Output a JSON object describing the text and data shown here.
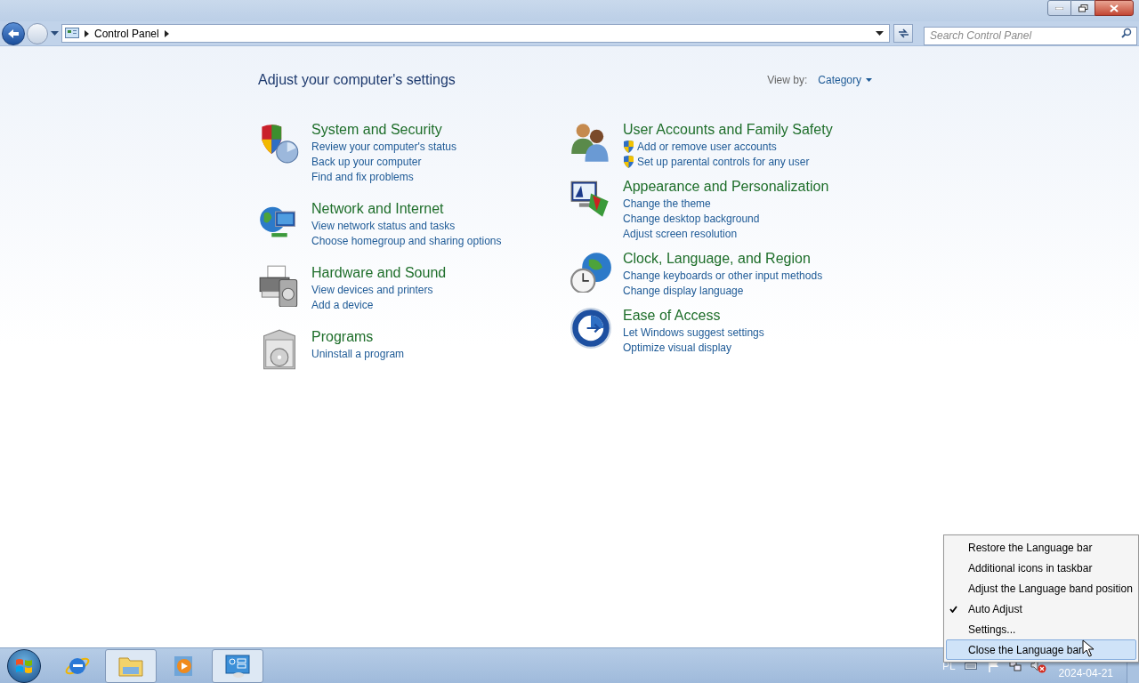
{
  "window": {
    "breadcrumb": "Control Panel",
    "search": {
      "placeholder": "Search Control Panel"
    }
  },
  "content": {
    "heading": "Adjust your computer's settings",
    "view_by": {
      "label": "View by:",
      "value": "Category"
    },
    "columns": [
      [
        {
          "kind": "security",
          "title": "System and Security",
          "links": [
            {
              "text": "Review your computer's status",
              "shield": false
            },
            {
              "text": "Back up your computer",
              "shield": false
            },
            {
              "text": "Find and fix problems",
              "shield": false
            }
          ]
        },
        {
          "kind": "network",
          "title": "Network and Internet",
          "links": [
            {
              "text": "View network status and tasks",
              "shield": false
            },
            {
              "text": "Choose homegroup and sharing options",
              "shield": false
            }
          ]
        },
        {
          "kind": "hardware",
          "title": "Hardware and Sound",
          "links": [
            {
              "text": "View devices and printers",
              "shield": false
            },
            {
              "text": "Add a device",
              "shield": false
            }
          ]
        },
        {
          "kind": "programs",
          "title": "Programs",
          "links": [
            {
              "text": "Uninstall a program",
              "shield": false
            }
          ]
        }
      ],
      [
        {
          "kind": "users",
          "title": "User Accounts and Family Safety",
          "links": [
            {
              "text": "Add or remove user accounts",
              "shield": true
            },
            {
              "text": "Set up parental controls for any user",
              "shield": true
            }
          ]
        },
        {
          "kind": "appearance",
          "title": "Appearance and Personalization",
          "links": [
            {
              "text": "Change the theme",
              "shield": false
            },
            {
              "text": "Change desktop background",
              "shield": false
            },
            {
              "text": "Adjust screen resolution",
              "shield": false
            }
          ]
        },
        {
          "kind": "clock",
          "title": "Clock, Language, and Region",
          "links": [
            {
              "text": "Change keyboards or other input methods",
              "shield": false
            },
            {
              "text": "Change display language",
              "shield": false
            }
          ]
        },
        {
          "kind": "access",
          "title": "Ease of Access",
          "links": [
            {
              "text": "Let Windows suggest settings",
              "shield": false
            },
            {
              "text": "Optimize visual display",
              "shield": false
            }
          ]
        }
      ]
    ]
  },
  "context_menu": {
    "items": [
      {
        "label": "Restore the Language bar",
        "checked": false,
        "selected": false
      },
      {
        "label": "Additional icons in taskbar",
        "checked": false,
        "selected": false
      },
      {
        "label": "Adjust the Language band position",
        "checked": false,
        "selected": false
      },
      {
        "label": "Auto Adjust",
        "checked": true,
        "selected": false
      },
      {
        "label": "Settings...",
        "checked": false,
        "selected": false
      },
      {
        "label": "Close the Language bar",
        "checked": false,
        "selected": true
      }
    ]
  },
  "taskbar": {
    "apps": [
      {
        "kind": "ie",
        "active": false
      },
      {
        "kind": "explorer",
        "active": true
      },
      {
        "kind": "media",
        "active": false
      },
      {
        "kind": "control",
        "active": true
      }
    ],
    "language": "PL",
    "date": "2024-04-21"
  }
}
